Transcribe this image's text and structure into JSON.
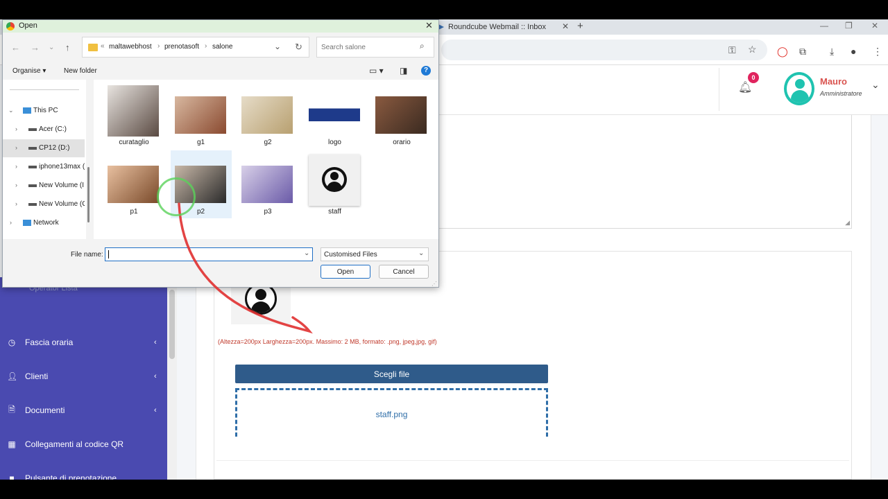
{
  "browser": {
    "tab_title": "Roundcube Webmail :: Inbox",
    "new_tab_symbol": "+"
  },
  "header": {
    "notification_count": "0",
    "user_name": "Mauro",
    "user_role": "Amministratore"
  },
  "sidebar": {
    "faded_item": "Operator Lista",
    "items": [
      {
        "label": "Fascia oraria",
        "icon": "clock-icon",
        "has_submenu": true
      },
      {
        "label": "Clienti",
        "icon": "user-icon",
        "has_submenu": true
      },
      {
        "label": "Documenti",
        "icon": "document-icon",
        "has_submenu": true
      },
      {
        "label": "Collegamenti al codice QR",
        "icon": "qr-icon",
        "has_submenu": false
      },
      {
        "label": "Pulsante di prenotazione",
        "icon": "square-icon",
        "has_submenu": false
      }
    ]
  },
  "upload": {
    "hint": "(Altezza=200px Larghezza=200px. Massimo: 2 MB, formato: .png, jpeg,jpg, gif)",
    "choose_label": "Scegli file",
    "selected_file": "staff.png"
  },
  "dialog": {
    "title": "Open",
    "breadcrumb_prefix": "«",
    "breadcrumb": [
      "maltawebhost",
      "prenotasoft",
      "salone"
    ],
    "search_placeholder": "Search salone",
    "organise_label": "Organise ▾",
    "new_folder_label": "New folder",
    "nav_items": [
      {
        "label": "This PC",
        "icon": "pc-icon"
      },
      {
        "label": "Acer (C:)",
        "icon": "drive-icon"
      },
      {
        "label": "CP12 (D:)",
        "icon": "drive-icon",
        "selected": true
      },
      {
        "label": "iphone13max (",
        "icon": "drive-icon"
      },
      {
        "label": "New Volume (I",
        "icon": "drive-icon"
      },
      {
        "label": "New Volume (G",
        "icon": "drive-icon"
      },
      {
        "label": "Network",
        "icon": "network-icon"
      }
    ],
    "files": [
      {
        "name": "curataglio",
        "colors": [
          "#e8e4e0",
          "#5a4a42"
        ]
      },
      {
        "name": "g1",
        "colors": [
          "#d8b8a0",
          "#8a4a30"
        ]
      },
      {
        "name": "g2",
        "colors": [
          "#e6dcc8",
          "#b8a070"
        ]
      },
      {
        "name": "logo",
        "colors": [
          "#ffffff",
          "#1e3a8a"
        ]
      },
      {
        "name": "orario",
        "colors": [
          "#8a5a40",
          "#3a2a20"
        ]
      },
      {
        "name": "p1",
        "colors": [
          "#e8c0a0",
          "#7a4a2a"
        ]
      },
      {
        "name": "p2",
        "colors": [
          "#c8b8a8",
          "#2a2a2a"
        ]
      },
      {
        "name": "p3",
        "colors": [
          "#d8d0e8",
          "#6a5aa8"
        ]
      },
      {
        "name": "staff",
        "colors": [
          "#f0f0f0",
          "#111111"
        ]
      }
    ],
    "filename_label": "File name:",
    "filename_value": "",
    "filetype_label": "Customised Files",
    "open_label": "Open",
    "cancel_label": "Cancel"
  },
  "colors": {
    "sidebar_bg": "#4a4ab0",
    "accent_teal": "#1fc3b0",
    "button_blue": "#2f5b8a",
    "annotation_red": "#e03030"
  }
}
